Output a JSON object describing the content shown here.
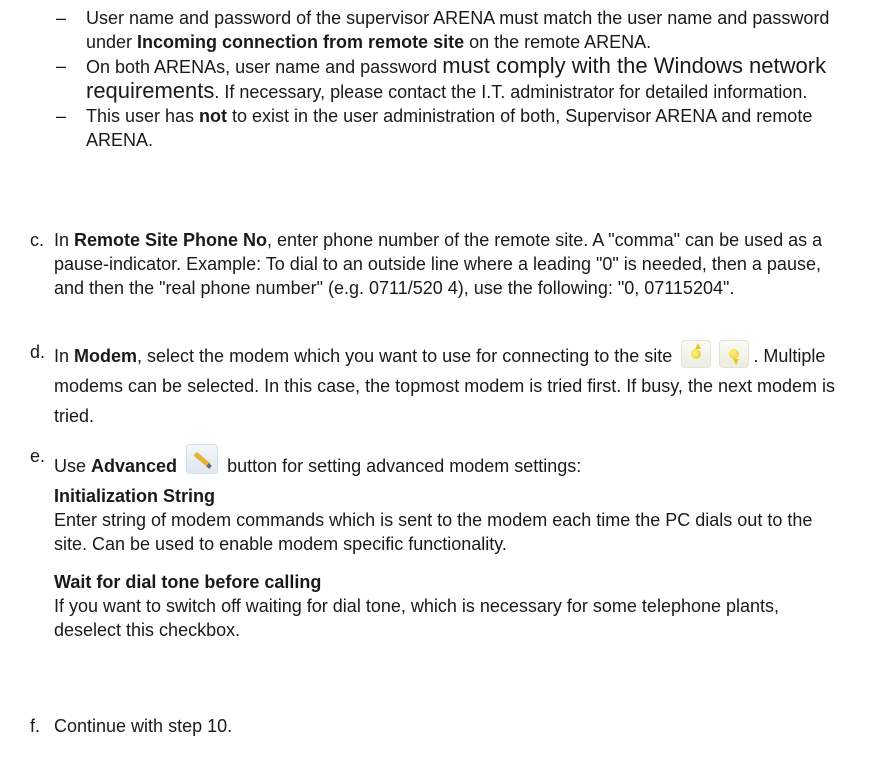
{
  "dash_items": [
    {
      "dash": "–",
      "p1": "User name and password of the supervisor ARENA must match the user name and password under ",
      "bold": "Incoming connection from remote site",
      "p2": " on the remote ARENA."
    },
    {
      "dash": "–",
      "p1": "On both ARENAs, user name and password ",
      "big": "must comply with the Windows network requirements",
      "p2": ". If necessary, please contact the I.T. administrator for detailed information."
    },
    {
      "dash": "–",
      "p1": "This user has ",
      "bold": "not",
      "p2": " to exist in the user administration of both, Supervisor ARENA and remote ARENA."
    }
  ],
  "steps": {
    "c": {
      "letter": "c.",
      "p1": "In ",
      "bold": "Remote Site Phone No",
      "p2": ", enter phone number of the remote site. A \"comma\" can be used as a pause-indicator. Example: To dial to an outside line where a leading \"0\" is needed, then a pause, and then the \"real phone number\" (e.g. 0711/520 4), use the following: \"0, 07115204\"."
    },
    "d": {
      "letter": "d.",
      "p1": "In ",
      "bold": "Modem",
      "p2": ", select the modem which you want to use for connecting to the site",
      "p3": ". Multiple modems can be selected. In this case, the topmost modem is tried first. If busy, the next modem is tried."
    },
    "e": {
      "letter": "e.",
      "p1": "Use ",
      "bold": "Advanced",
      "p2": " button for setting advanced modem settings:",
      "sub1_title": "Initialization String",
      "sub1_text": "Enter string of modem commands which is sent to the modem each time the PC dials out to the site. Can be used to enable modem specific functionality.",
      "sub2_title": "Wait for dial tone before calling",
      "sub2_text": "If you want to switch off waiting for dial tone, which is necessary for some telephone plants, deselect this checkbox."
    },
    "f": {
      "letter": "f.",
      "text": "Continue with step 10."
    }
  },
  "icons": {
    "add": "move-up-icon",
    "remove": "move-down-icon",
    "advanced": "pencil-edit-icon"
  }
}
